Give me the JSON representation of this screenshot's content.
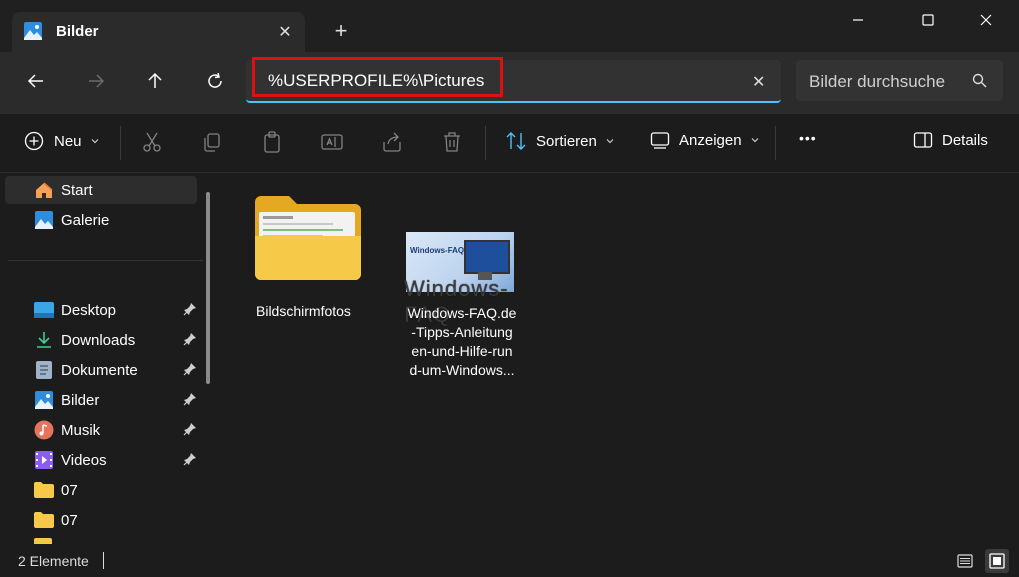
{
  "window": {
    "tab_title": "Bilder",
    "new_tab_symbol": "+",
    "tab_close_symbol": "✕"
  },
  "address": {
    "path": "%USERPROFILE%\\Pictures",
    "clear_symbol": "✕",
    "search_placeholder": "Bilder durchsuche",
    "highlight_color": "#e01010",
    "accent_color": "#4cc2ff"
  },
  "toolbar": {
    "new_label": "Neu",
    "sort_label": "Sortieren",
    "view_label": "Anzeigen",
    "more_label": "•••",
    "details_label": "Details"
  },
  "sidebar": {
    "items": [
      {
        "label": "Start",
        "icon": "home-icon",
        "pinned": false,
        "selected": true
      },
      {
        "label": "Galerie",
        "icon": "gallery-icon",
        "pinned": false
      },
      {
        "label": "Desktop",
        "icon": "desktop-icon",
        "pinned": true
      },
      {
        "label": "Downloads",
        "icon": "download-icon",
        "pinned": true
      },
      {
        "label": "Dokumente",
        "icon": "document-icon",
        "pinned": true
      },
      {
        "label": "Bilder",
        "icon": "pictures-icon",
        "pinned": true
      },
      {
        "label": "Musik",
        "icon": "music-icon",
        "pinned": true
      },
      {
        "label": "Videos",
        "icon": "video-icon",
        "pinned": true
      },
      {
        "label": "07",
        "icon": "folder-icon",
        "pinned": false
      },
      {
        "label": "07",
        "icon": "folder-icon",
        "pinned": false
      }
    ]
  },
  "content": {
    "folder_label": "Bildschirmfotos",
    "image_label_lines": [
      "Windows-FAQ.de",
      "-Tipps-Anleitung",
      "en-und-Hilfe-run",
      "d-um-Windows..."
    ],
    "thumbnail_logo": "Windows-FAQ.de",
    "watermark": "Windows-FAQ"
  },
  "status": {
    "count": "2 Elemente"
  }
}
